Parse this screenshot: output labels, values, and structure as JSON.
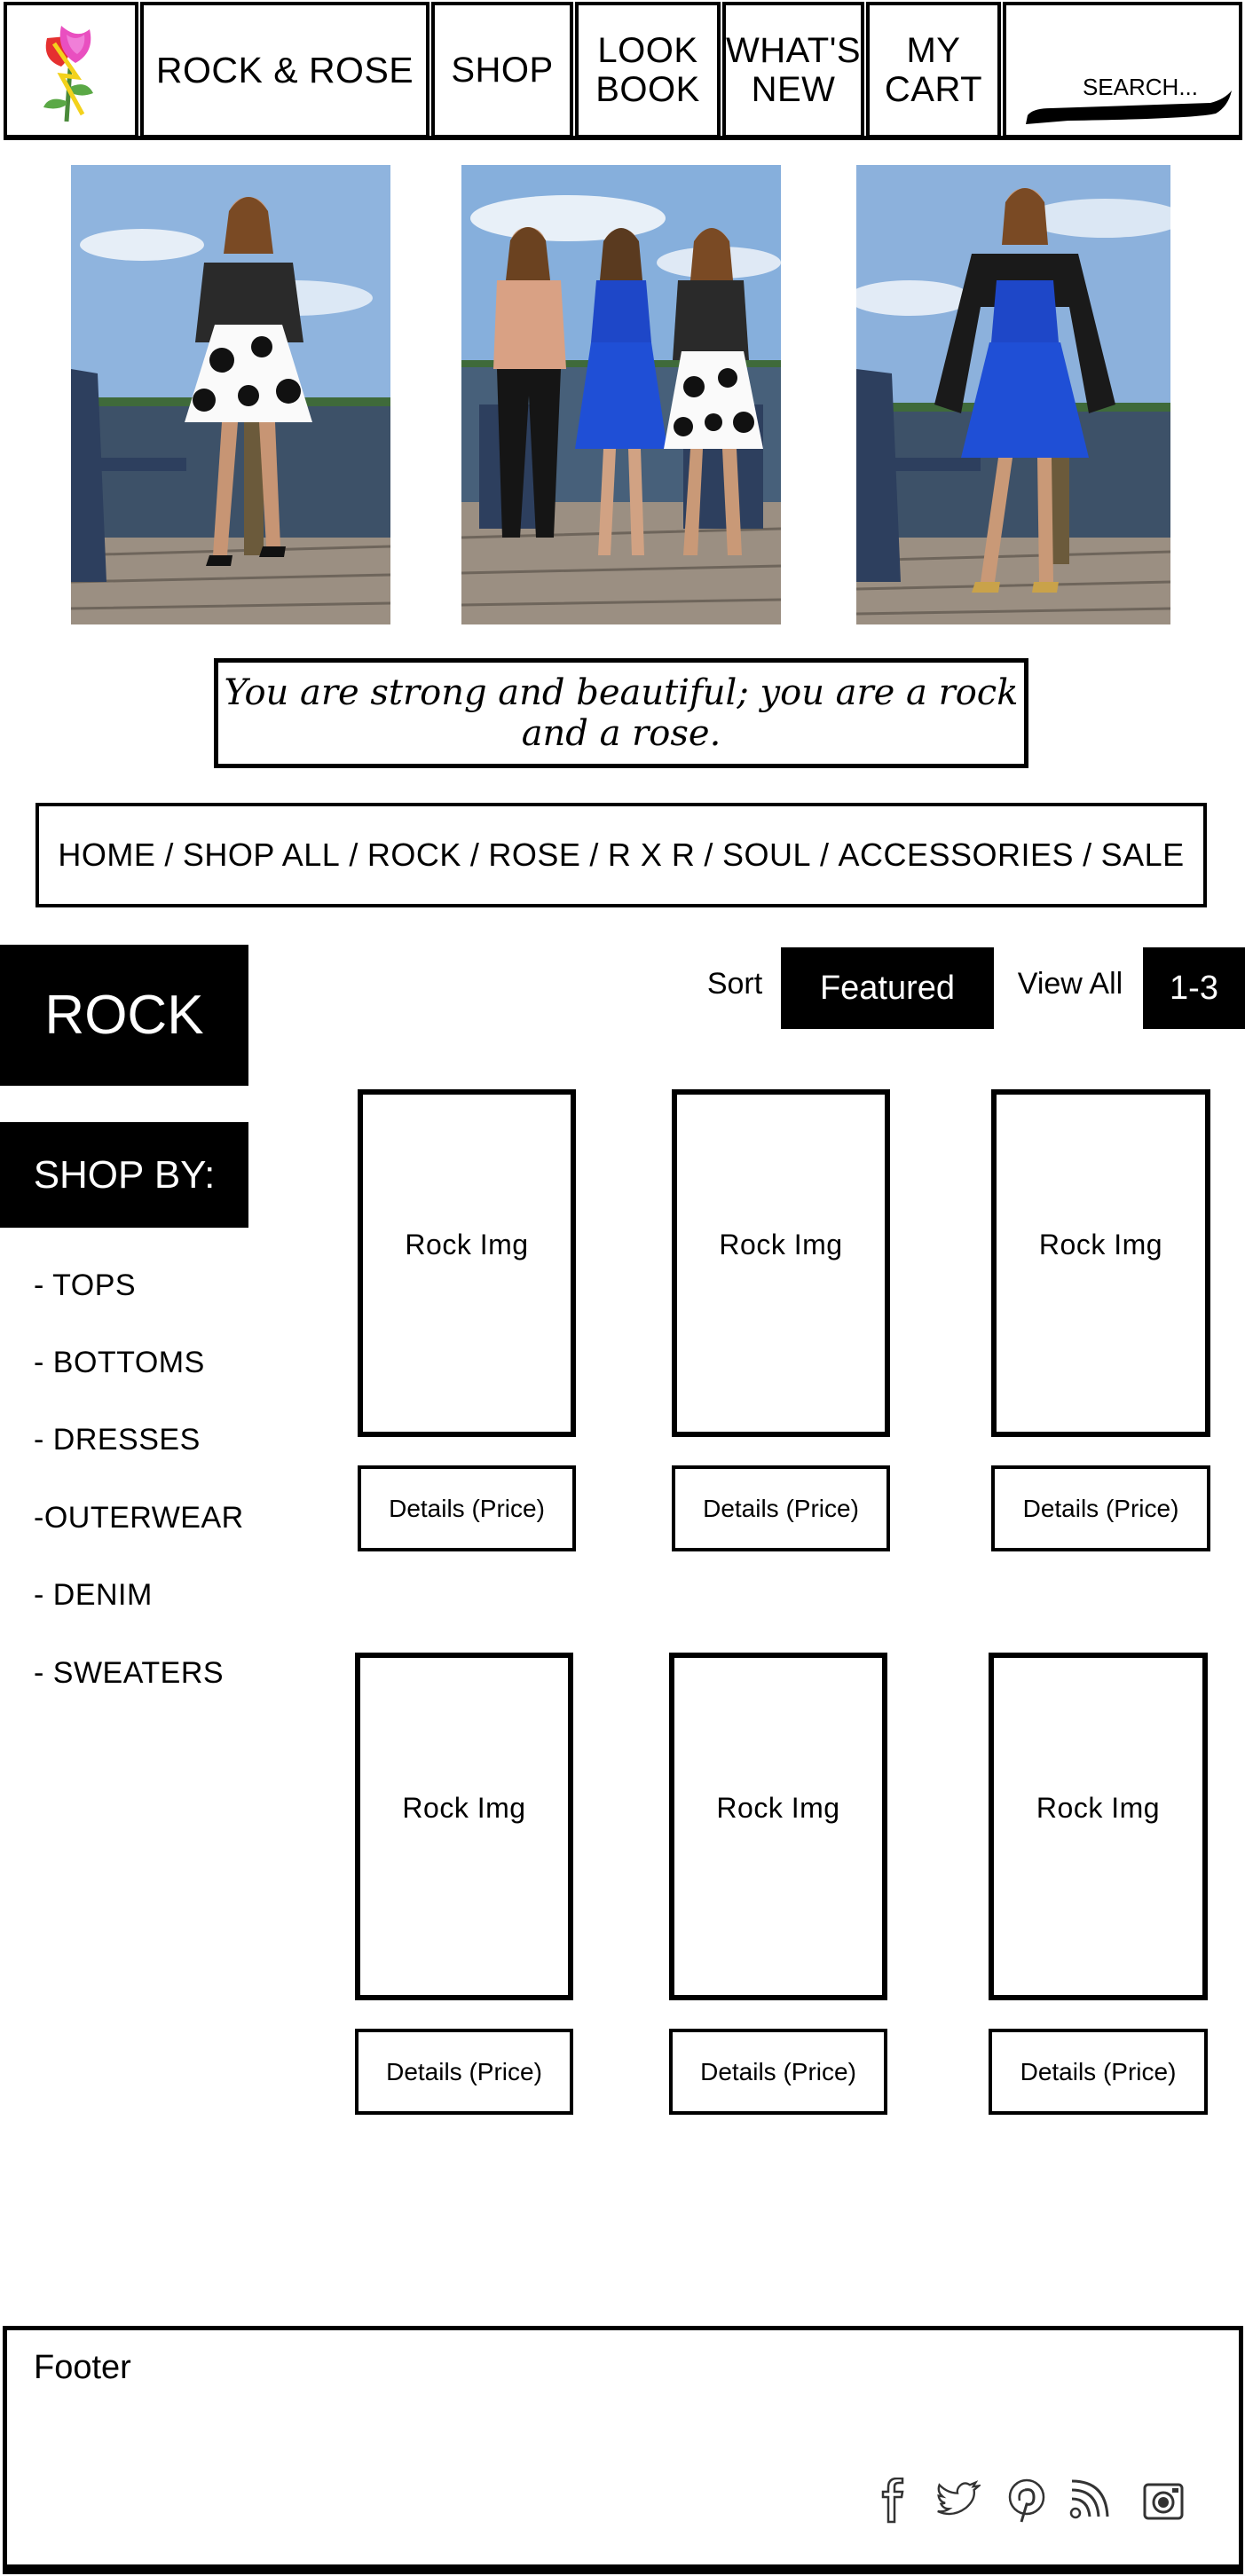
{
  "header": {
    "brand": "ROCK & ROSE",
    "nav": {
      "shop": "SHOP",
      "lookbook_line1": "LOOK",
      "lookbook_line2": "BOOK",
      "new_line1": "WHAT'S",
      "new_line2": "NEW",
      "cart_line1": "MY",
      "cart_line2": "CART"
    },
    "search_placeholder": "SEARCH..."
  },
  "tagline": "You are strong and beautiful; you are a rock and a rose.",
  "breadcrumb": [
    "HOME",
    "SHOP ALL",
    "ROCK",
    "ROSE",
    "R X R",
    "SOUL",
    "ACCESSORIES",
    "SALE"
  ],
  "breadcrumb_separator": "/",
  "category": {
    "title": "ROCK",
    "shop_by_label": "SHOP BY:",
    "shop_by": [
      "- TOPS",
      "- BOTTOMS",
      "- DRESSES",
      "-OUTERWEAR",
      "- DENIM",
      "- SWEATERS"
    ]
  },
  "controls": {
    "sort_label": "Sort",
    "sort_value": "Featured",
    "view_label": "View All",
    "range": "1-3"
  },
  "products": [
    {
      "image_label": "Rock Img",
      "details_label": "Details (Price)"
    },
    {
      "image_label": "Rock Img",
      "details_label": "Details (Price)"
    },
    {
      "image_label": "Rock Img",
      "details_label": "Details (Price)"
    },
    {
      "image_label": "Rock Img",
      "details_label": "Details (Price)"
    },
    {
      "image_label": "Rock Img",
      "details_label": "Details (Price)"
    },
    {
      "image_label": "Rock Img",
      "details_label": "Details (Price)"
    }
  ],
  "footer": {
    "label": "Footer",
    "social_icons": [
      "facebook-icon",
      "twitter-icon",
      "pinterest-icon",
      "rss-icon",
      "instagram-icon"
    ]
  },
  "colors": {
    "ink": "#000000",
    "paper": "#ffffff",
    "sky": "#7ea7d6",
    "water": "#3d5168",
    "dock": "#9b8f82",
    "chair": "#2d3f5e",
    "dress_blue": "#1f4fd6"
  }
}
